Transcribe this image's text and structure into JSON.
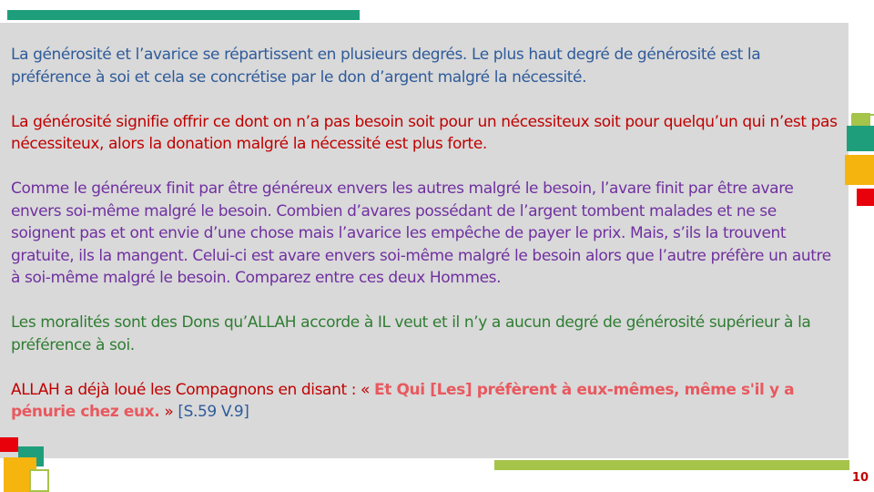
{
  "slide": {
    "paragraphs": [
      "La générosité et l’avarice se répartissent en plusieurs degrés. Le plus haut degré de générosité est la préférence à soi et cela se concrétise par le don d’argent malgré la nécessité.",
      "La générosité signifie offrir ce dont on n’a pas besoin soit pour un nécessiteux soit pour quelqu’un qui n’est pas nécessiteux, alors la donation malgré la nécessité est plus forte.",
      "Comme le généreux finit par être généreux envers les autres malgré le besoin, l’avare finit par être avare envers soi-même malgré le besoin. Combien d’avares possédant de l’argent tombent malades et ne se soignent pas et ont envie d’une chose mais l’avarice les empêche de payer le prix. Mais, s’ils la trouvent gratuite, ils la mangent. Celui-ci est avare envers soi-même malgré le besoin alors que l’autre préfère un autre à soi-même malgré le besoin. Comparez entre ces deux Hommes.",
      "Les moralités sont des Dons qu’ALLAH accorde à IL veut et il n’y a aucun degré de générosité supérieur à la préférence à soi."
    ],
    "last_paragraph": {
      "intro": "ALLAH a déjà loué les Compagnons en disant : « ",
      "quote": "Et Qui [Les] préfèrent à eux-mêmes, même s'il y a pénurie chez eux.",
      "close": " » ",
      "reference": "[S.59 V.9]"
    },
    "page_number": "10"
  },
  "colors": {
    "teal": "#1f9e7c",
    "green": "#a5c44a",
    "orange": "#f6b40e",
    "red": "#e8000b",
    "box": "#d9d9d9"
  }
}
